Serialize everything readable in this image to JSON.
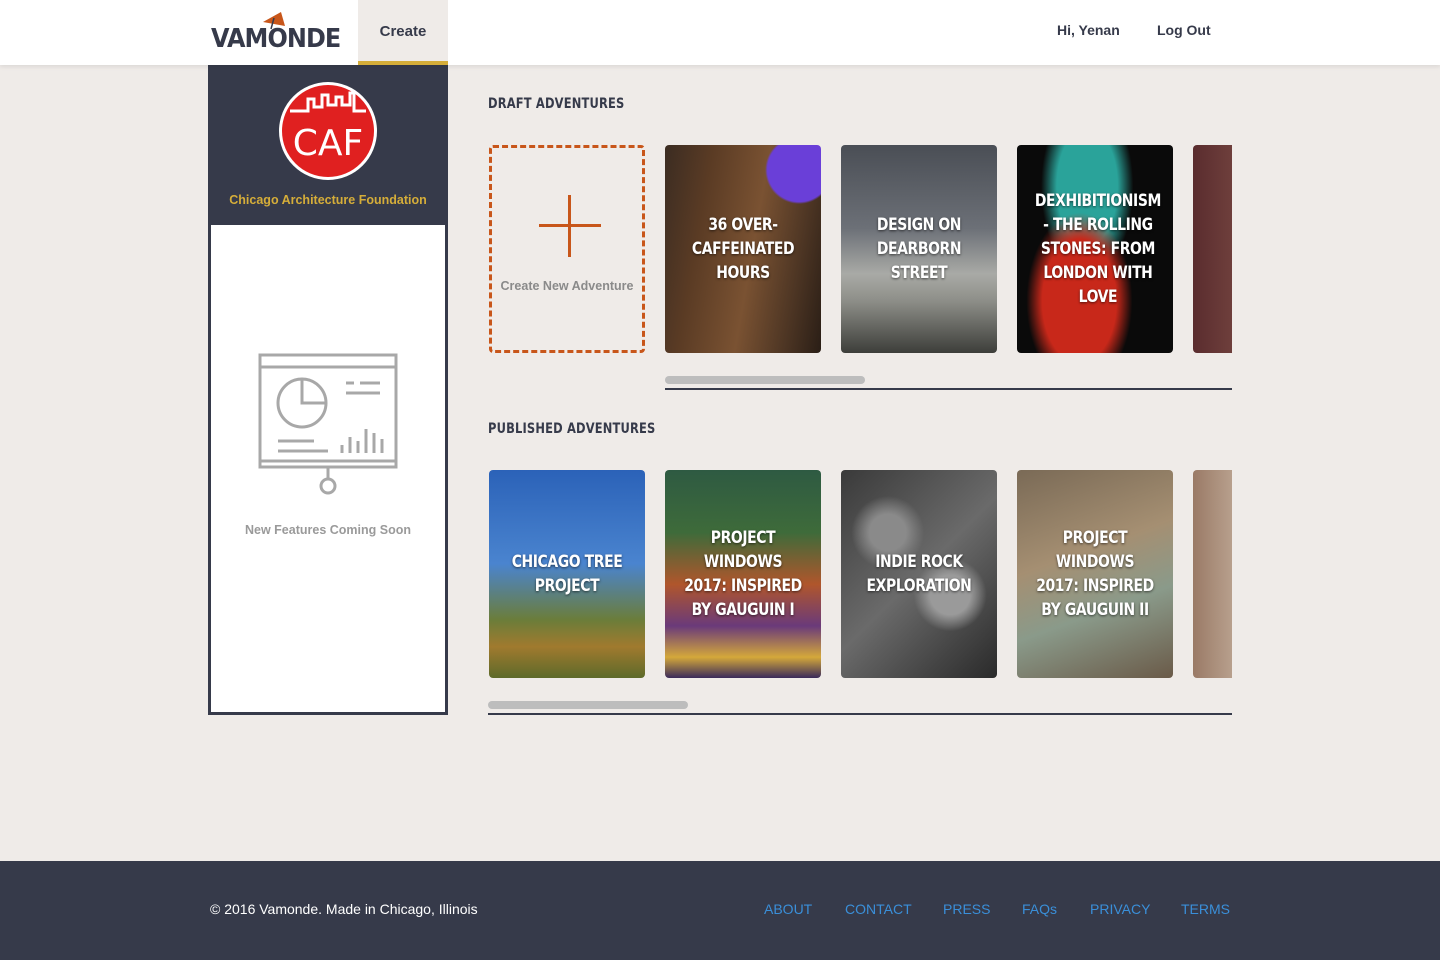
{
  "header": {
    "logo_text": "VAMONDE",
    "create_tab": "Create",
    "greeting": "Hi, Yenan",
    "logout": "Log Out"
  },
  "sidebar": {
    "org_logo_text": "CAF",
    "org_name": "Chicago Architecture Foundation",
    "coming_soon": "New Features Coming Soon"
  },
  "drafts": {
    "title": "DRAFT ADVENTURES",
    "create_label": "Create New Adventure",
    "cards": [
      {
        "title": "36 Over-Caffeinated Hours"
      },
      {
        "title": "Design on Dearborn Street"
      },
      {
        "title": "Dexhibitionism - The Rolling Stones: From London With Love"
      },
      {
        "title": ""
      }
    ],
    "scroll_position": 0
  },
  "published": {
    "title": "PUBLISHED ADVENTURES",
    "cards": [
      {
        "title": "Chicago Tree Project"
      },
      {
        "title": "Project Windows 2017: Inspired by Gauguin I"
      },
      {
        "title": "Indie Rock Exploration"
      },
      {
        "title": "Project Windows 2017: Inspired by Gauguin II"
      },
      {
        "title": ""
      }
    ],
    "scroll_position": 0
  },
  "footer": {
    "copyright": "© 2016 Vamonde. Made in Chicago, Illinois",
    "links": [
      "ABOUT",
      "CONTACT",
      "PRESS",
      "FAQs",
      "PRIVACY",
      "TERMS"
    ]
  },
  "colors": {
    "navy": "#363a4a",
    "gold": "#d5ad39",
    "orange": "#c8561a",
    "link_blue": "#3a8fd9",
    "caf_red": "#e02020"
  }
}
